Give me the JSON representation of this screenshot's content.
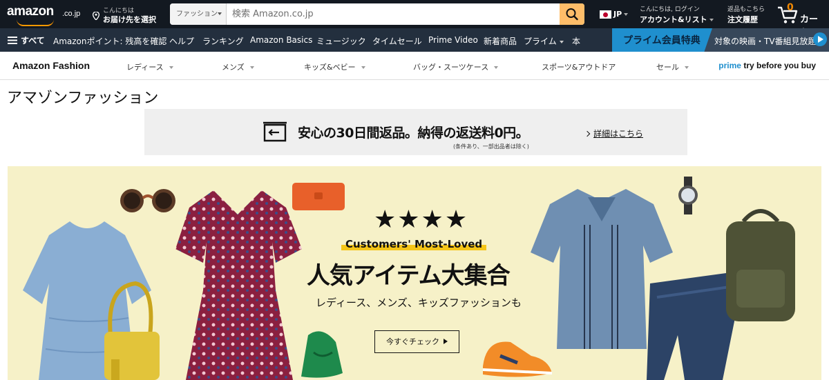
{
  "topbar": {
    "logo_text": "amazon",
    "logo_suffix": ".co.jp",
    "deliver_line1": "こんにちは",
    "deliver_line2": "お届け先を選択",
    "search_category": "ファッション",
    "search_placeholder": "検索 Amazon.co.jp",
    "lang": "JP",
    "account_line1": "こんにちは, ログイン",
    "account_line2": "アカウント&リスト",
    "orders_line1": "返品もこちら",
    "orders_line2": "注文履歴",
    "cart_count": "0",
    "cart_label": "カート"
  },
  "navbar": {
    "all_label": "すべて",
    "items": [
      "Amazonポイント: 残高を確認",
      "ヘルプ",
      "ランキング",
      "Amazon Basics",
      "ミュージック",
      "タイムセール",
      "Prime Video",
      "新着商品",
      "プライム",
      "本"
    ],
    "prime_banner_title": "プライム会員特典",
    "prime_banner_text": "対象の映画・TV番組見放題"
  },
  "fashion_nav": {
    "brand": "Amazon Fashion",
    "items": [
      "レディース",
      "メンズ",
      "キッズ&ベビー",
      "バッグ・スーツケース",
      "スポーツ&アウトドア",
      "セール"
    ],
    "prime_word": "prime",
    "tbyb_rest": "try before you buy"
  },
  "page": {
    "title": "アマゾンファッション"
  },
  "returns_banner": {
    "main": "安心の30日間返品。納得の返送料0円。",
    "note": "(条件あり、一部出品者は除く)",
    "more": "詳細はこちら"
  },
  "hero": {
    "stars": "★★★★",
    "tagline": "Customers' Most-Loved",
    "title": "人気アイテム大集合",
    "subtitle": "レディース、メンズ、キッズファッションも",
    "button": "今すぐチェック"
  },
  "colors": {
    "topbar": "#131921",
    "navbar": "#232f3e",
    "search_button": "#febd69",
    "accent": "#ff9900",
    "prime_blue": "#1f8fce",
    "hero_bg": "#f6f1c8"
  }
}
